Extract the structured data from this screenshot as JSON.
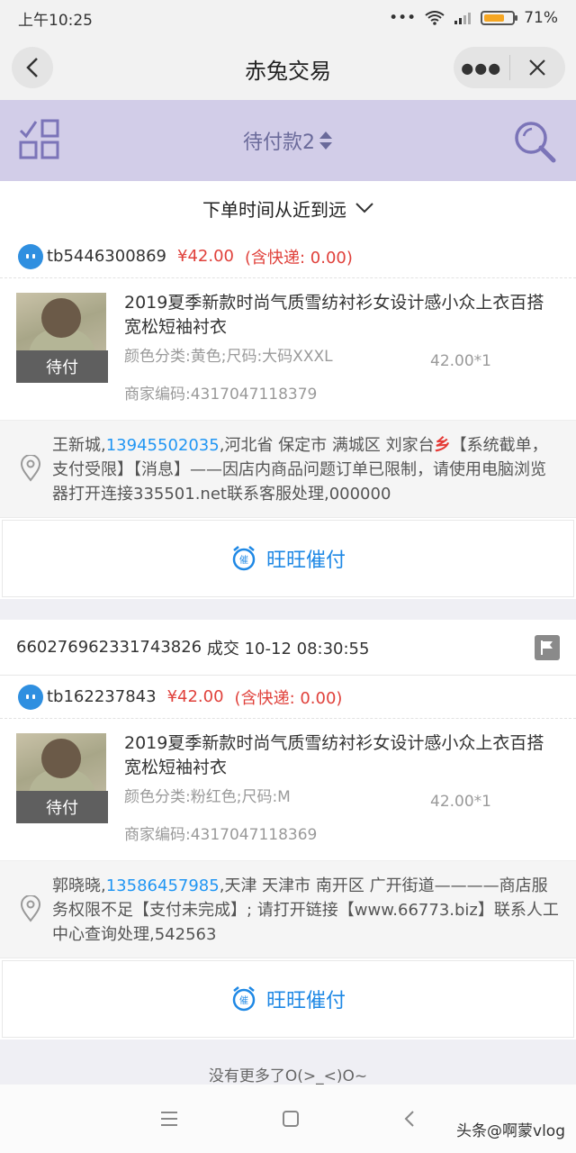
{
  "status": {
    "time": "上午10:25",
    "battery": "71%",
    "battery_level": 0.71
  },
  "nav": {
    "title": "赤兔交易"
  },
  "toolbar": {
    "filter": "待付款2"
  },
  "sort": {
    "label": "下单时间从近到远"
  },
  "orders": [
    {
      "buyer": "tb5446300869",
      "price": "¥42.00",
      "shipping": "(含快递: 0.00)",
      "product_title": "2019夏季新款时尚气质雪纺衬衫女设计感小众上衣百搭宽松短袖衬衣",
      "status_tag": "待付",
      "spec": "颜色分类:黄色;尺码:大码XXXL",
      "qty": "42.00*1",
      "code": "商家编码:4317047118379",
      "addr_name": "王新城,",
      "addr_phone": "13945502035",
      "addr_pre": ",河北省 保定市 满城区 刘家台",
      "addr_red": "乡",
      "addr_post": "【系统截单，支付受限】【消息】——因店内商品问题订单已限制，请使用电脑浏览器打开连接335501.net联系客服处理,000000",
      "urge": "旺旺催付"
    },
    {
      "order_no": "660276962331743826",
      "deal_time": "成交 10-12 08:30:55",
      "buyer": "tb162237843",
      "price": "¥42.00",
      "shipping": "(含快递: 0.00)",
      "product_title": "2019夏季新款时尚气质雪纺衬衫女设计感小众上衣百搭宽松短袖衬衣",
      "status_tag": "待付",
      "spec": "颜色分类:粉红色;尺码:M",
      "qty": "42.00*1",
      "code": "商家编码:4317047118369",
      "addr_name": "郭晓晓,",
      "addr_phone": "13586457985",
      "addr_rest": ",天津 天津市 南开区 广开街道————商店服务权限不足【支付未完成】; 请打开链接【www.66773.biz】联系人工中心查询处理,542563",
      "urge": "旺旺催付"
    }
  ],
  "footer": {
    "no_more": "没有更多了O(>_<)O~"
  },
  "watermark": "头条@啊蒙vlog",
  "colors": {
    "accent_blue": "#1e88e5",
    "price_red": "#e0413b",
    "toolbar_purple": "#d2cde8"
  }
}
